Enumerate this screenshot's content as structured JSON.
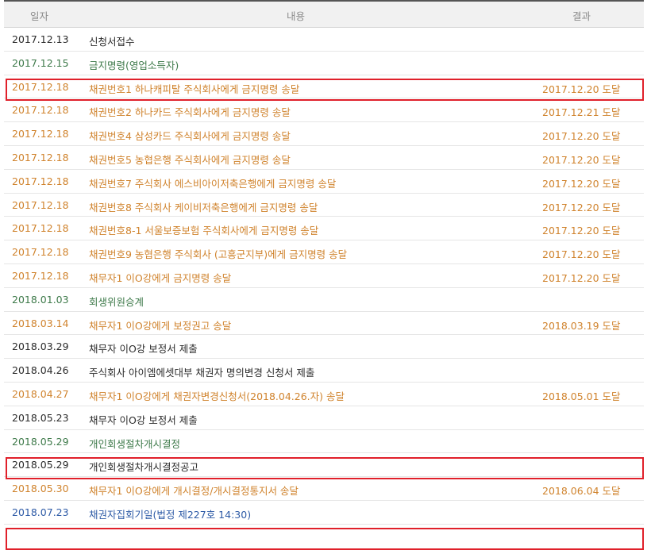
{
  "header": {
    "date": "일자",
    "content": "내용",
    "result": "결과"
  },
  "rows": [
    {
      "date": "2017.12.13",
      "content": "신청서접수",
      "result": "",
      "color": "black",
      "highlighted": false
    },
    {
      "date": "2017.12.15",
      "content": "금지명령(영업소득자)",
      "result": "",
      "color": "green",
      "highlighted": true
    },
    {
      "date": "2017.12.18",
      "content": "채권번호1 하나캐피탈 주식회사에게 금지명령 송달",
      "result": "2017.12.20 도달",
      "color": "orange",
      "highlighted": false
    },
    {
      "date": "2017.12.18",
      "content": "채권번호2 하나카드 주식회사에게 금지명령 송달",
      "result": "2017.12.21 도달",
      "color": "orange",
      "highlighted": false
    },
    {
      "date": "2017.12.18",
      "content": "채권번호4 삼성카드 주식회사에게 금지명령 송달",
      "result": "2017.12.20 도달",
      "color": "orange",
      "highlighted": false
    },
    {
      "date": "2017.12.18",
      "content": "채권번호5 농협은행 주식회사에게 금지명령 송달",
      "result": "2017.12.20 도달",
      "color": "orange",
      "highlighted": false
    },
    {
      "date": "2017.12.18",
      "content": "채권번호7 주식회사 에스비아이저축은행에게 금지명령 송달",
      "result": "2017.12.20 도달",
      "color": "orange",
      "highlighted": false
    },
    {
      "date": "2017.12.18",
      "content": "채권번호8 주식회사 케이비저축은행에게 금지명령 송달",
      "result": "2017.12.20 도달",
      "color": "orange",
      "highlighted": false
    },
    {
      "date": "2017.12.18",
      "content": "채권번호8-1 서울보증보험 주식회사에게 금지명령 송달",
      "result": "2017.12.20 도달",
      "color": "orange",
      "highlighted": false
    },
    {
      "date": "2017.12.18",
      "content": "채권번호9 농협은행 주식회사 (고흥군지부)에게 금지명령 송달",
      "result": "2017.12.20 도달",
      "color": "orange",
      "highlighted": false
    },
    {
      "date": "2017.12.18",
      "content": "채무자1 이O강에게 금지명령 송달",
      "result": "2017.12.20 도달",
      "color": "orange",
      "highlighted": false
    },
    {
      "date": "2018.01.03",
      "content": "회생위원승계",
      "result": "",
      "color": "green",
      "highlighted": false
    },
    {
      "date": "2018.03.14",
      "content": "채무자1 이O강에게 보정권고 송달",
      "result": "2018.03.19 도달",
      "color": "orange",
      "highlighted": false
    },
    {
      "date": "2018.03.29",
      "content": "채무자 이O강 보정서 제출",
      "result": "",
      "color": "black",
      "highlighted": false
    },
    {
      "date": "2018.04.26",
      "content": "주식회사 아이엠에셋대부 채권자 명의변경 신청서 제출",
      "result": "",
      "color": "black",
      "highlighted": false
    },
    {
      "date": "2018.04.27",
      "content": "채무자1 이O강에게 채권자변경신청서(2018.04.26.자) 송달",
      "result": "2018.05.01 도달",
      "color": "orange",
      "highlighted": false
    },
    {
      "date": "2018.05.23",
      "content": "채무자 이O강 보정서 제출",
      "result": "",
      "color": "black",
      "highlighted": false
    },
    {
      "date": "2018.05.29",
      "content": "개인회생절차개시결정",
      "result": "",
      "color": "green",
      "highlighted": true
    },
    {
      "date": "2018.05.29",
      "content": "개인회생절차개시결정공고",
      "result": "",
      "color": "black",
      "highlighted": false
    },
    {
      "date": "2018.05.30",
      "content": "채무자1 이O강에게 개시결정/개시결정통지서 송달",
      "result": "2018.06.04 도달",
      "color": "orange",
      "highlighted": false
    },
    {
      "date": "2018.07.23",
      "content": "채권자집회기일(법정 제227호 14:30)",
      "result": "",
      "color": "blue",
      "highlighted": true
    }
  ]
}
